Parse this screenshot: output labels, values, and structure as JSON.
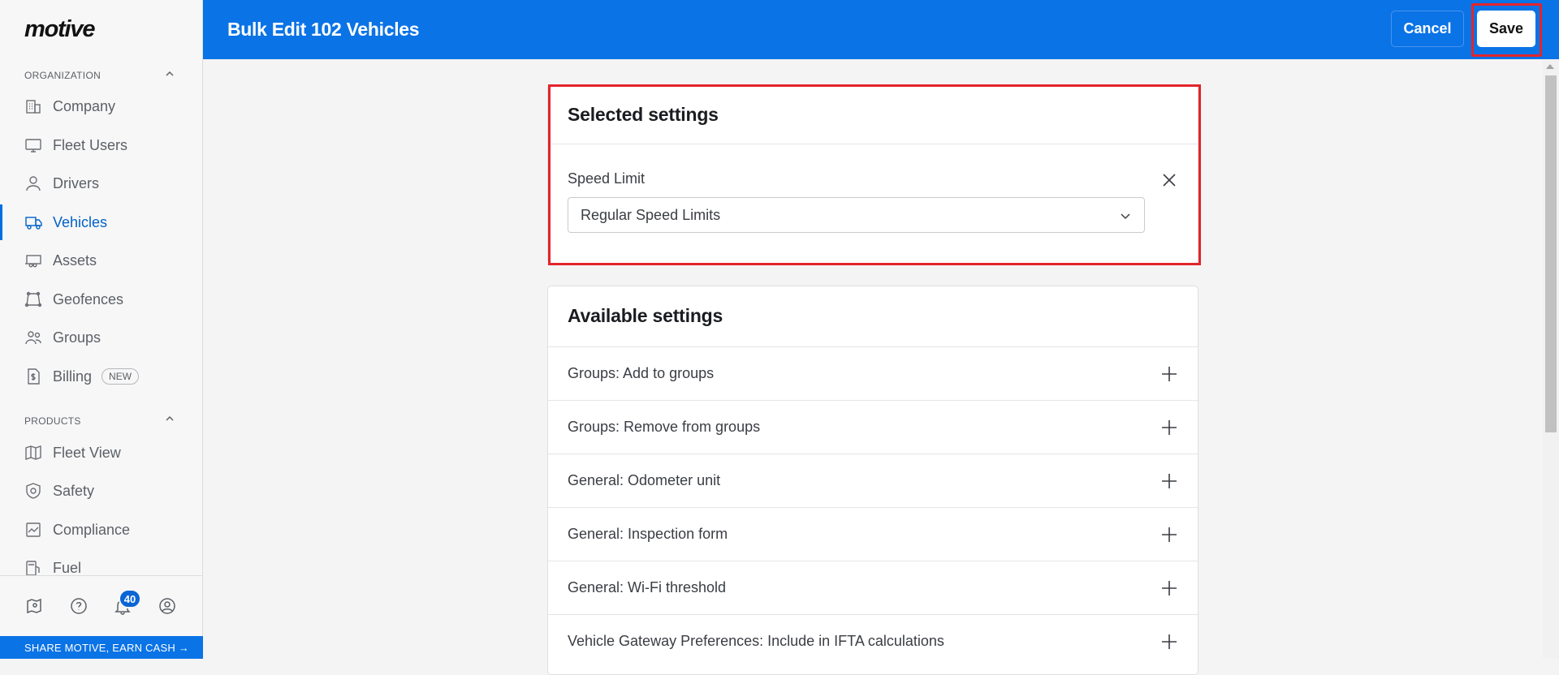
{
  "sidebar": {
    "logo": "motive",
    "organization_title": "ORGANIZATION",
    "organization_items": [
      {
        "label": "Company",
        "icon": "building-icon"
      },
      {
        "label": "Fleet Users",
        "icon": "monitor-icon"
      },
      {
        "label": "Drivers",
        "icon": "person-icon"
      },
      {
        "label": "Vehicles",
        "icon": "truck-icon",
        "active": true
      },
      {
        "label": "Assets",
        "icon": "trailer-icon"
      },
      {
        "label": "Geofences",
        "icon": "polygon-icon"
      },
      {
        "label": "Groups",
        "icon": "people-icon"
      },
      {
        "label": "Billing",
        "icon": "billing-icon",
        "badge": "NEW"
      }
    ],
    "products_title": "PRODUCTS",
    "products_items": [
      {
        "label": "Fleet View",
        "icon": "map-icon"
      },
      {
        "label": "Safety",
        "icon": "shield-icon"
      },
      {
        "label": "Compliance",
        "icon": "compliance-icon"
      },
      {
        "label": "Fuel",
        "icon": "fuel-icon"
      }
    ],
    "notification_count": "40",
    "share_banner": "SHARE MOTIVE, EARN CASH →"
  },
  "header": {
    "title": "Bulk Edit 102 Vehicles",
    "cancel_label": "Cancel",
    "save_label": "Save"
  },
  "selected_settings": {
    "title": "Selected settings",
    "field_label": "Speed Limit",
    "field_value": "Regular Speed Limits"
  },
  "available_settings": {
    "title": "Available settings",
    "items": [
      "Groups: Add to groups",
      "Groups: Remove from groups",
      "General: Odometer unit",
      "General: Inspection form",
      "General: Wi-Fi threshold",
      "Vehicle Gateway Preferences: Include in IFTA calculations"
    ]
  },
  "colors": {
    "brand_blue": "#0a73e6",
    "highlight_red": "#e3242b",
    "active_text": "#0062c8"
  }
}
